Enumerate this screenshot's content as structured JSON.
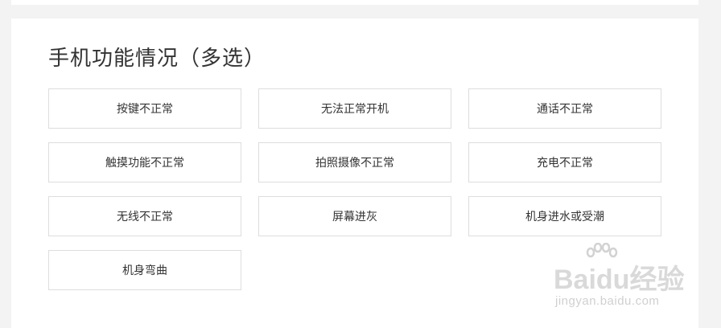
{
  "section": {
    "title": "手机功能情况（多选）",
    "options": [
      "按键不正常",
      "无法正常开机",
      "通话不正常",
      "触摸功能不正常",
      "拍照摄像不正常",
      "充电不正常",
      "无线不正常",
      "屏幕进灰",
      "机身进水或受潮",
      "机身弯曲"
    ]
  },
  "watermark": {
    "brand": "Baidu经验",
    "url": "jingyan.baidu.com"
  }
}
